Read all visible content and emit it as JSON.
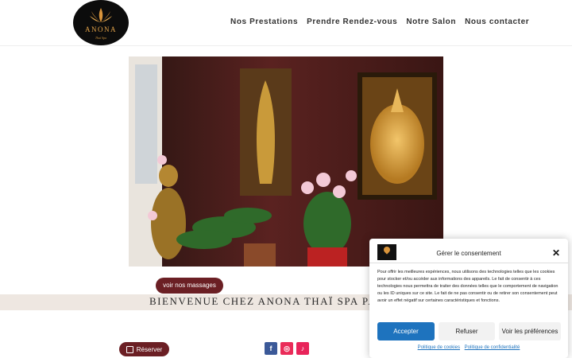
{
  "header": {
    "logo_name": "ANONA",
    "logo_tagline": "Thaï Spa",
    "nav": [
      "Nos Prestations",
      "Prendre Rendez-vous",
      "Notre Salon",
      "Nous contacter"
    ]
  },
  "hero": {
    "icon": "hero-photo"
  },
  "content": {
    "massage_button": "voir nos massages",
    "welcome": "BIENVENUE CHEZ ANONA THAÏ SPA PAR",
    "reserve_button": "Réserver",
    "social": {
      "facebook": "f",
      "instagram": "◎",
      "tiktok": "♪"
    }
  },
  "consent": {
    "title": "Gérer le consentement",
    "close": "✕",
    "text": "Pour offrir les meilleures expériences, nous utilisons des technologies telles que les cookies pour stocker et/ou accéder aux informations des appareils. Le fait de consentir à ces technologies nous permettra de traiter des données telles que le comportement de navigation ou les ID uniques sur ce site. Le fait de ne pas consentir ou de retirer son consentement peut avoir un effet négatif sur certaines caractéristiques et fonctions.",
    "accept": "Accepter",
    "refuse": "Refuser",
    "preferences": "Voir les préférences",
    "cookie_policy": "Politique de cookies",
    "privacy_policy": "Politique de confidentialité"
  },
  "colors": {
    "brand": "#6b1f24",
    "accept": "#1e73be",
    "band": "#eee7e1"
  }
}
